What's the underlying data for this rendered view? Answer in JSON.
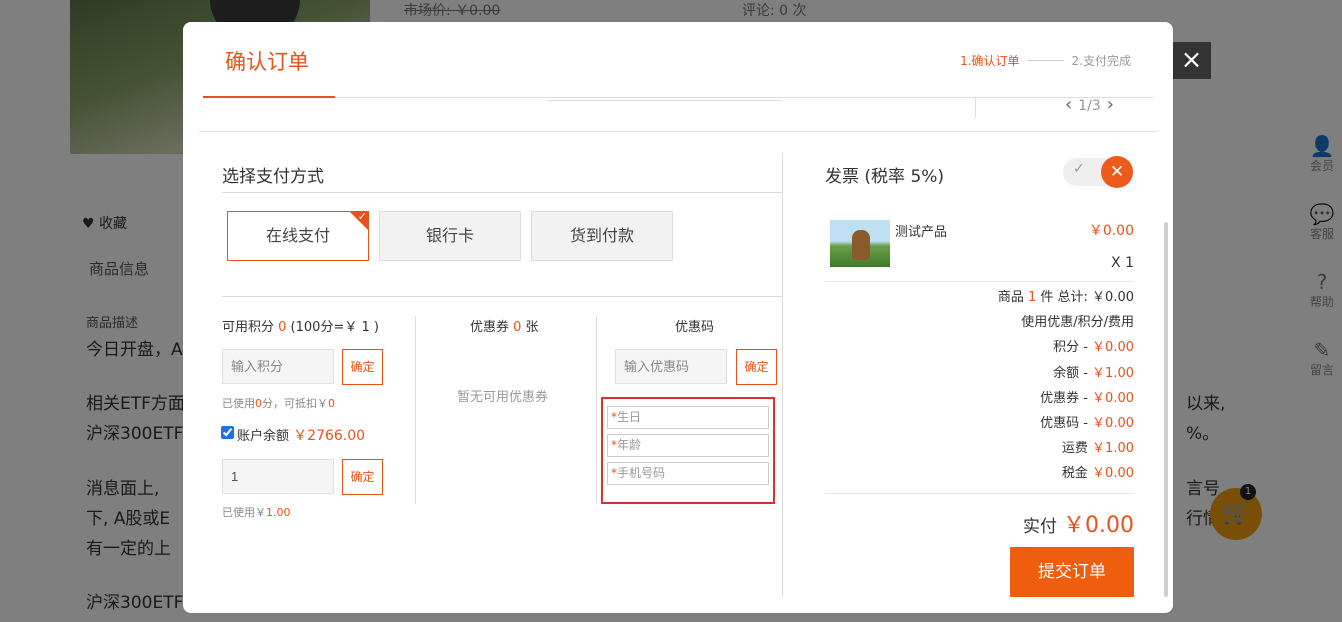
{
  "background": {
    "market_price": "市场价: ￥0.00",
    "comments": "评论: 0 次",
    "favorite": "♥ 收藏",
    "product_info_tab": "商品信息",
    "desc_label": "商品描述",
    "line1": "今日开盘，A",
    "line2a": "相关ETF方面",
    "line2b": "沪深300ETF",
    "line2c": "以来,",
    "line2d": "%。",
    "line3a": "消息面上,",
    "line3b": "下, A股或E",
    "line3c": "有一定的上",
    "line3d": "言号",
    "line3e": "行情",
    "line4": "沪深300ETF",
    "side": [
      {
        "icon": "👤",
        "label": "会员"
      },
      {
        "icon": "💬",
        "label": "客服"
      },
      {
        "icon": "?",
        "label": "帮助"
      },
      {
        "icon": "✎",
        "label": "留言"
      }
    ],
    "cart_count": "1"
  },
  "modal": {
    "title": "确认订单",
    "step1": "1.确认订单",
    "step2": "2.支付完成",
    "pager": "1/3",
    "close": "×"
  },
  "payment": {
    "title": "选择支付方式",
    "methods": [
      "在线支付",
      "银行卡",
      "货到付款"
    ]
  },
  "points": {
    "label_prefix": "可用积分 ",
    "value": "0",
    "label_suffix": " (100分=￥ 1 )",
    "placeholder": "输入积分",
    "confirm": "确定",
    "used_prefix": "已使用",
    "used_points": "0",
    "used_mid": "分，可抵扣￥",
    "used_amount": "0"
  },
  "balance": {
    "label": "账户余额",
    "amount": "￥2766.00",
    "input_value": "1",
    "confirm": "确定",
    "used_prefix": "已使用￥",
    "used_amount": "1.00"
  },
  "coupon": {
    "label_prefix": "优惠券 ",
    "count": "0",
    "label_suffix": " 张",
    "none": "暂无可用优惠券"
  },
  "promo": {
    "label": "优惠码",
    "placeholder": "输入优惠码",
    "confirm": "确定",
    "fields": [
      "生日",
      "年龄",
      "手机号码"
    ],
    "required": "*"
  },
  "invoice": {
    "title": "发票 (税率 5%)",
    "check_icon": "✓",
    "close_icon": "✕"
  },
  "product": {
    "name": "测试产品",
    "price": "￥0.00",
    "qty": "X 1"
  },
  "summary": {
    "goods_prefix": "商品 ",
    "goods_count": "1",
    "goods_suffix": " 件 总计: ￥0.00",
    "use_label": "使用优惠/积分/费用",
    "rows": [
      {
        "label": "积分 - ",
        "value": "￥0.00"
      },
      {
        "label": "余额 - ",
        "value": "￥1.00"
      },
      {
        "label": "优惠券 - ",
        "value": "￥0.00"
      },
      {
        "label": "优惠码 - ",
        "value": "￥0.00"
      },
      {
        "label": "运费  ",
        "value": "￥1.00"
      },
      {
        "label": "税金  ",
        "value": "￥0.00"
      }
    ],
    "total_label": "实付",
    "total_value": "￥0.00",
    "submit": "提交订单"
  }
}
